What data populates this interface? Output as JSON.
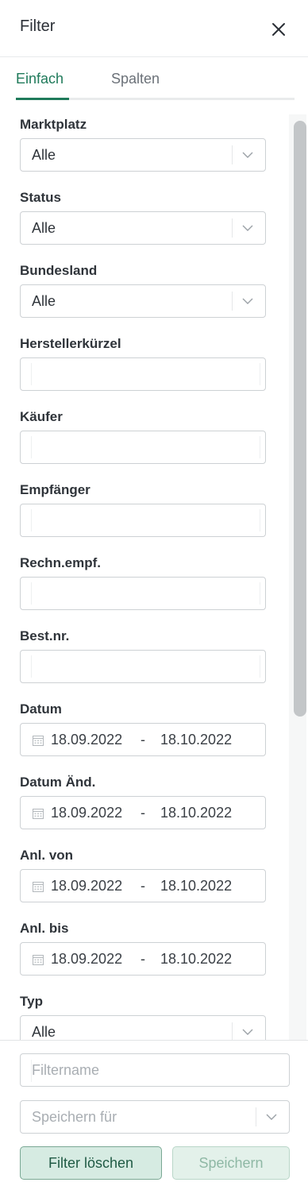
{
  "header": {
    "title": "Filter",
    "close_icon": "close-icon"
  },
  "tabs": [
    {
      "label": "Einfach",
      "active": true
    },
    {
      "label": "Spalten",
      "active": false
    }
  ],
  "fields": {
    "marktplatz": {
      "label": "Marktplatz",
      "value": "Alle"
    },
    "status": {
      "label": "Status",
      "value": "Alle"
    },
    "bundesland": {
      "label": "Bundesland",
      "value": "Alle"
    },
    "herstellerkuerzel": {
      "label": "Herstellerkürzel",
      "value": ""
    },
    "kaeufer": {
      "label": "Käufer",
      "value": ""
    },
    "empfaenger": {
      "label": "Empfänger",
      "value": ""
    },
    "rechn_empf": {
      "label": "Rechn.empf.",
      "value": ""
    },
    "best_nr": {
      "label": "Best.nr.",
      "value": ""
    },
    "datum": {
      "label": "Datum",
      "from": "18.09.2022",
      "dash": "-",
      "to": "18.10.2022"
    },
    "datum_aend": {
      "label": "Datum Änd.",
      "from": "18.09.2022",
      "dash": "-",
      "to": "18.10.2022"
    },
    "anl_von": {
      "label": "Anl. von",
      "from": "18.09.2022",
      "dash": "-",
      "to": "18.10.2022"
    },
    "anl_bis": {
      "label": "Anl. bis",
      "from": "18.09.2022",
      "dash": "-",
      "to": "18.10.2022"
    },
    "typ": {
      "label": "Typ",
      "value": "Alle"
    }
  },
  "footer": {
    "filtername_placeholder": "Filtername",
    "save_for_placeholder": "Speichern für",
    "clear_label": "Filter löschen",
    "save_label": "Speichern"
  },
  "colors": {
    "accent": "#1f7a5a",
    "clear_button_bg": "#d6ebe2",
    "save_button_bg": "#e3f1ea"
  }
}
